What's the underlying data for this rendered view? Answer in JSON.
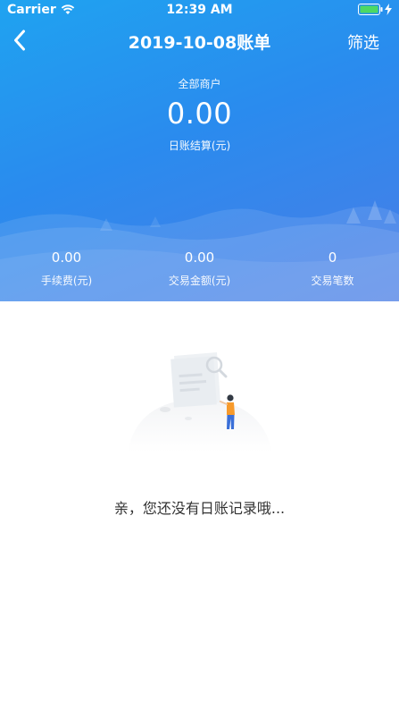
{
  "status_bar": {
    "carrier": "Carrier",
    "time": "12:39 AM"
  },
  "nav": {
    "title": "2019-10-08账单",
    "filter_label": "筛选",
    "back_icon": "chevron-left-icon"
  },
  "summary": {
    "merchant_label": "全部商户",
    "total_amount": "0.00",
    "total_caption": "日账结算(元)"
  },
  "stats": [
    {
      "value": "0.00",
      "label": "手续费(元)"
    },
    {
      "value": "0.00",
      "label": "交易金额(元)"
    },
    {
      "value": "0",
      "label": "交易笔数"
    }
  ],
  "empty_state": {
    "message": "亲，您还没有日账记录哦..."
  },
  "colors": {
    "header_start": "#1fa3f0",
    "header_end": "#4a7de6",
    "battery": "#4cd964",
    "figure_shirt": "#f79a2b",
    "figure_pants": "#3a6fd8"
  }
}
